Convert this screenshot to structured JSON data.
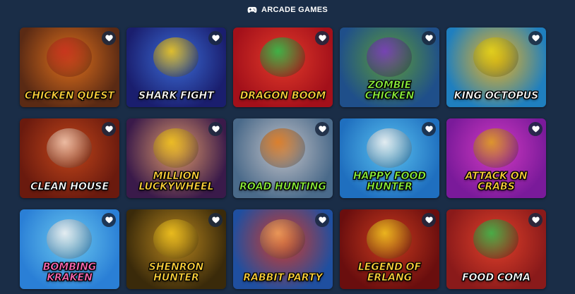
{
  "header": {
    "title": "ARCADE GAMES",
    "icon": "gamepad-icon"
  },
  "colors": {
    "background": "#1a2d47",
    "favorite_button": "#1a2840",
    "heart": "#ffffff"
  },
  "games": [
    {
      "title": "CHICKEN QUEST",
      "name": "chicken-quest",
      "bg1": "#5a2a14",
      "bg2": "#e0701c",
      "accent": "#c8321e",
      "text_color": "#ffd23a"
    },
    {
      "title": "SHARK FIGHT",
      "name": "shark-fight",
      "bg1": "#1a1e6e",
      "bg2": "#3b6bd6",
      "accent": "#f0c81e",
      "text_color": "#ffffff"
    },
    {
      "title": "DRAGON BOOM",
      "name": "dragon-boom",
      "bg1": "#a3101a",
      "bg2": "#e23a2a",
      "accent": "#2fbf4a",
      "text_color": "#ffd23a"
    },
    {
      "title": "ZOMBIE CHICKEN",
      "name": "zombie-chicken",
      "bg1": "#1f4f8a",
      "bg2": "#5b9b3a",
      "accent": "#7a3bbf",
      "text_color": "#8bf03a"
    },
    {
      "title": "KING OCTOPUS",
      "name": "king-octopus",
      "bg1": "#1f7fbf",
      "bg2": "#f0b41e",
      "accent": "#e3d21a",
      "text_color": "#ffffff"
    },
    {
      "title": "CLEAN HOUSE",
      "name": "clean-house",
      "bg1": "#6a1a0e",
      "bg2": "#c2461a",
      "accent": "#f2c8b0",
      "text_color": "#ffffff"
    },
    {
      "title": "MILLION LUCKYWHEEL",
      "name": "million-luckywheel",
      "bg1": "#3a1a4a",
      "bg2": "#e09a6a",
      "accent": "#f0c21e",
      "text_color": "#ffd23a"
    },
    {
      "title": "ROAD HUNTING",
      "name": "road-hunting",
      "bg1": "#4a6a8a",
      "bg2": "#c2c2c8",
      "accent": "#e07a1e",
      "text_color": "#8bf03a"
    },
    {
      "title": "HAPPY FOOD HUNTER",
      "name": "happy-food-hunter",
      "bg1": "#1f6fbf",
      "bg2": "#5ac2f0",
      "accent": "#f2f2f2",
      "text_color": "#8bf03a"
    },
    {
      "title": "Attack on Crabs",
      "name": "attack-on-crabs",
      "bg1": "#7a1a9a",
      "bg2": "#d23ac2",
      "accent": "#e0a01e",
      "text_color": "#ffd23a"
    },
    {
      "title": "BOMBING KRAKEN",
      "name": "bombing-kraken",
      "bg1": "#2a7fd6",
      "bg2": "#6ac8f0",
      "accent": "#f2f2f2",
      "text_color": "#ff6ab4"
    },
    {
      "title": "SHENRON HUNTER",
      "name": "shenron-hunter",
      "bg1": "#3a2a0a",
      "bg2": "#b8861e",
      "accent": "#f0c21e",
      "text_color": "#ffd23a"
    },
    {
      "title": "Rabbit Party",
      "name": "rabbit-party",
      "bg1": "#1f4fa0",
      "bg2": "#d23a2a",
      "accent": "#f0a05a",
      "text_color": "#ffd23a"
    },
    {
      "title": "LEGEND OF ERLANG",
      "name": "legend-of-erlang",
      "bg1": "#6a0e0e",
      "bg2": "#c83a1e",
      "accent": "#f0c21e",
      "text_color": "#ffd23a"
    },
    {
      "title": "FOOD COMA",
      "name": "food-coma",
      "bg1": "#8a1a1a",
      "bg2": "#e0402a",
      "accent": "#3ab84a",
      "text_color": "#ffffff"
    }
  ]
}
